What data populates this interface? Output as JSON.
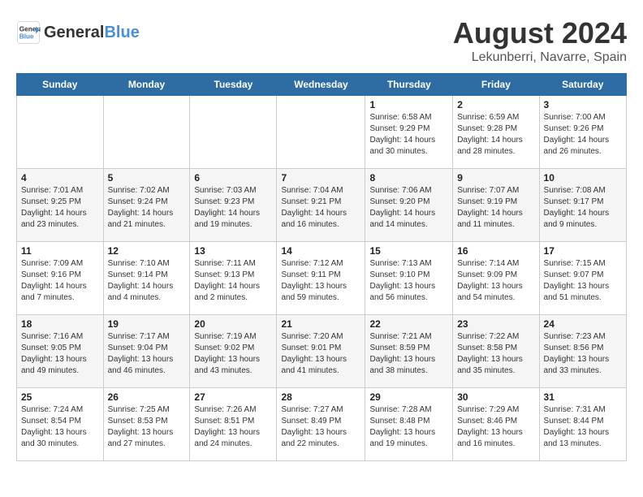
{
  "header": {
    "logo_line1": "General",
    "logo_line2": "Blue",
    "month_year": "August 2024",
    "location": "Lekunberri, Navarre, Spain"
  },
  "days_of_week": [
    "Sunday",
    "Monday",
    "Tuesday",
    "Wednesday",
    "Thursday",
    "Friday",
    "Saturday"
  ],
  "weeks": [
    [
      {
        "day": "",
        "info": ""
      },
      {
        "day": "",
        "info": ""
      },
      {
        "day": "",
        "info": ""
      },
      {
        "day": "",
        "info": ""
      },
      {
        "day": "1",
        "info": "Sunrise: 6:58 AM\nSunset: 9:29 PM\nDaylight: 14 hours\nand 30 minutes."
      },
      {
        "day": "2",
        "info": "Sunrise: 6:59 AM\nSunset: 9:28 PM\nDaylight: 14 hours\nand 28 minutes."
      },
      {
        "day": "3",
        "info": "Sunrise: 7:00 AM\nSunset: 9:26 PM\nDaylight: 14 hours\nand 26 minutes."
      }
    ],
    [
      {
        "day": "4",
        "info": "Sunrise: 7:01 AM\nSunset: 9:25 PM\nDaylight: 14 hours\nand 23 minutes."
      },
      {
        "day": "5",
        "info": "Sunrise: 7:02 AM\nSunset: 9:24 PM\nDaylight: 14 hours\nand 21 minutes."
      },
      {
        "day": "6",
        "info": "Sunrise: 7:03 AM\nSunset: 9:23 PM\nDaylight: 14 hours\nand 19 minutes."
      },
      {
        "day": "7",
        "info": "Sunrise: 7:04 AM\nSunset: 9:21 PM\nDaylight: 14 hours\nand 16 minutes."
      },
      {
        "day": "8",
        "info": "Sunrise: 7:06 AM\nSunset: 9:20 PM\nDaylight: 14 hours\nand 14 minutes."
      },
      {
        "day": "9",
        "info": "Sunrise: 7:07 AM\nSunset: 9:19 PM\nDaylight: 14 hours\nand 11 minutes."
      },
      {
        "day": "10",
        "info": "Sunrise: 7:08 AM\nSunset: 9:17 PM\nDaylight: 14 hours\nand 9 minutes."
      }
    ],
    [
      {
        "day": "11",
        "info": "Sunrise: 7:09 AM\nSunset: 9:16 PM\nDaylight: 14 hours\nand 7 minutes."
      },
      {
        "day": "12",
        "info": "Sunrise: 7:10 AM\nSunset: 9:14 PM\nDaylight: 14 hours\nand 4 minutes."
      },
      {
        "day": "13",
        "info": "Sunrise: 7:11 AM\nSunset: 9:13 PM\nDaylight: 14 hours\nand 2 minutes."
      },
      {
        "day": "14",
        "info": "Sunrise: 7:12 AM\nSunset: 9:11 PM\nDaylight: 13 hours\nand 59 minutes."
      },
      {
        "day": "15",
        "info": "Sunrise: 7:13 AM\nSunset: 9:10 PM\nDaylight: 13 hours\nand 56 minutes."
      },
      {
        "day": "16",
        "info": "Sunrise: 7:14 AM\nSunset: 9:09 PM\nDaylight: 13 hours\nand 54 minutes."
      },
      {
        "day": "17",
        "info": "Sunrise: 7:15 AM\nSunset: 9:07 PM\nDaylight: 13 hours\nand 51 minutes."
      }
    ],
    [
      {
        "day": "18",
        "info": "Sunrise: 7:16 AM\nSunset: 9:05 PM\nDaylight: 13 hours\nand 49 minutes."
      },
      {
        "day": "19",
        "info": "Sunrise: 7:17 AM\nSunset: 9:04 PM\nDaylight: 13 hours\nand 46 minutes."
      },
      {
        "day": "20",
        "info": "Sunrise: 7:19 AM\nSunset: 9:02 PM\nDaylight: 13 hours\nand 43 minutes."
      },
      {
        "day": "21",
        "info": "Sunrise: 7:20 AM\nSunset: 9:01 PM\nDaylight: 13 hours\nand 41 minutes."
      },
      {
        "day": "22",
        "info": "Sunrise: 7:21 AM\nSunset: 8:59 PM\nDaylight: 13 hours\nand 38 minutes."
      },
      {
        "day": "23",
        "info": "Sunrise: 7:22 AM\nSunset: 8:58 PM\nDaylight: 13 hours\nand 35 minutes."
      },
      {
        "day": "24",
        "info": "Sunrise: 7:23 AM\nSunset: 8:56 PM\nDaylight: 13 hours\nand 33 minutes."
      }
    ],
    [
      {
        "day": "25",
        "info": "Sunrise: 7:24 AM\nSunset: 8:54 PM\nDaylight: 13 hours\nand 30 minutes."
      },
      {
        "day": "26",
        "info": "Sunrise: 7:25 AM\nSunset: 8:53 PM\nDaylight: 13 hours\nand 27 minutes."
      },
      {
        "day": "27",
        "info": "Sunrise: 7:26 AM\nSunset: 8:51 PM\nDaylight: 13 hours\nand 24 minutes."
      },
      {
        "day": "28",
        "info": "Sunrise: 7:27 AM\nSunset: 8:49 PM\nDaylight: 13 hours\nand 22 minutes."
      },
      {
        "day": "29",
        "info": "Sunrise: 7:28 AM\nSunset: 8:48 PM\nDaylight: 13 hours\nand 19 minutes."
      },
      {
        "day": "30",
        "info": "Sunrise: 7:29 AM\nSunset: 8:46 PM\nDaylight: 13 hours\nand 16 minutes."
      },
      {
        "day": "31",
        "info": "Sunrise: 7:31 AM\nSunset: 8:44 PM\nDaylight: 13 hours\nand 13 minutes."
      }
    ]
  ]
}
